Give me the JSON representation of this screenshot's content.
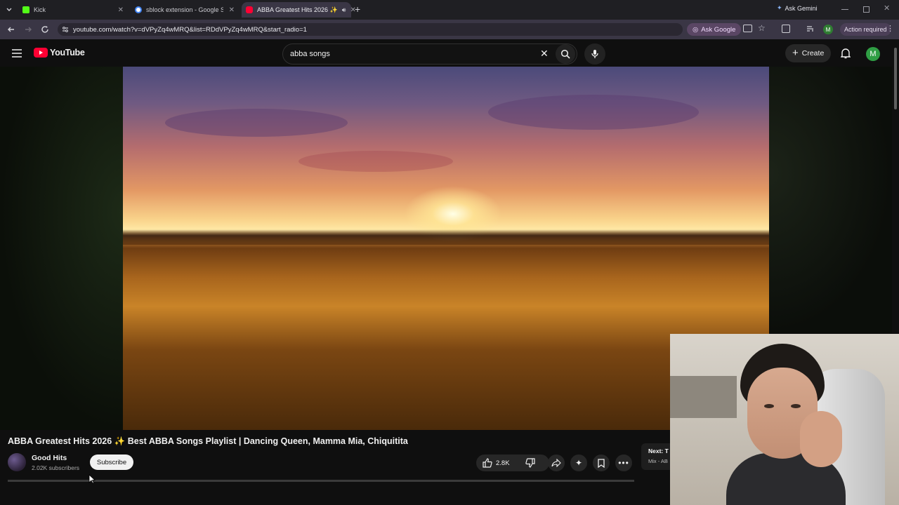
{
  "browser": {
    "tabs": [
      {
        "label": "Kick",
        "favicon_color": "#53fc18"
      },
      {
        "label": "sblock extension - Google Search",
        "favicon_color": "#4285f4"
      },
      {
        "label": "ABBA Greatest Hits 2026 ✨",
        "favicon_color": "#ff0033"
      }
    ],
    "new_tab": "+",
    "ask_gemini": "Ask Gemini",
    "url": "youtube.com/watch?v=dVPyZq4wMRQ&list=RDdVPyZq4wMRQ&start_radio=1",
    "ask_google": "Ask Google",
    "profile_initial": "M",
    "action_required": "Action required"
  },
  "youtube": {
    "logo_text": "YouTube",
    "search_value": "abba songs",
    "create_label": "Create",
    "avatar_initial": "M",
    "accent": "#ff0033"
  },
  "video": {
    "title": "ABBA Greatest Hits 2026 ✨ Best ABBA Songs Playlist | Dancing Queen, Mamma Mia, Chiquitita",
    "channel": "Good Hits",
    "subscribers": "2.02K subscribers",
    "subscribe_label": "Subscribe",
    "likes": "2.8K",
    "next_label": "Next: T",
    "next_sub": "Mix - AB"
  }
}
